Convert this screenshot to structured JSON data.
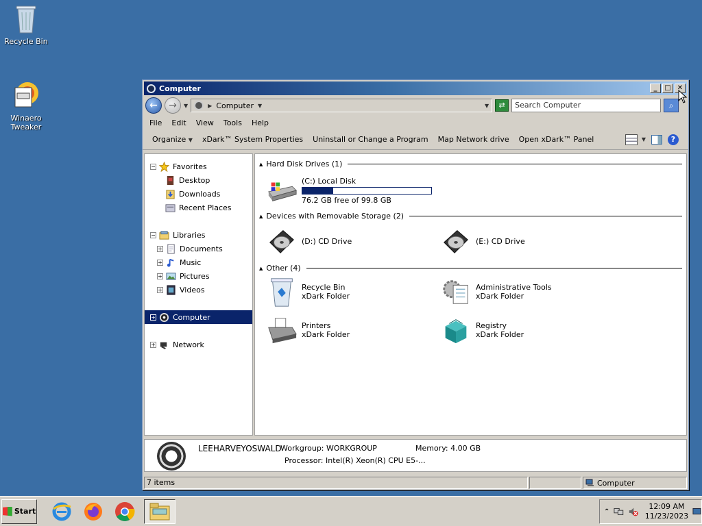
{
  "desktop": {
    "icons": [
      {
        "label": "Recycle Bin"
      },
      {
        "label": "Winaero Tweaker"
      }
    ]
  },
  "window": {
    "title": "Computer",
    "address": {
      "location": "Computer"
    },
    "search_placeholder": "Search Computer",
    "menu": [
      "File",
      "Edit",
      "View",
      "Tools",
      "Help"
    ],
    "commands": [
      "Organize",
      "xDark™ System Properties",
      "Uninstall or Change a Program",
      "Map Network drive",
      "Open xDark™ Panel"
    ],
    "nav": {
      "favorites": {
        "label": "Favorites",
        "items": [
          "Desktop",
          "Downloads",
          "Recent Places"
        ]
      },
      "libraries": {
        "label": "Libraries",
        "items": [
          "Documents",
          "Music",
          "Pictures",
          "Videos"
        ]
      },
      "computer": "Computer",
      "network": "Network"
    },
    "groups": {
      "hdd": {
        "header": "Hard Disk Drives (1)"
      },
      "removable": {
        "header": "Devices with Removable Storage (2)"
      },
      "other": {
        "header": "Other (4)"
      }
    },
    "drives": {
      "c": {
        "name": "(C:) Local Disk",
        "free_text": "76.2 GB free of 99.8 GB",
        "used_fraction": 0.24
      },
      "d": {
        "name": "(D:) CD Drive"
      },
      "e": {
        "name": "(E:) CD Drive"
      }
    },
    "other_items": [
      {
        "name": "Recycle Bin",
        "type": "xDark Folder"
      },
      {
        "name": "Administrative Tools",
        "type": "xDark Folder"
      },
      {
        "name": "Printers",
        "type": "xDark Folder"
      },
      {
        "name": "Registry",
        "type": "xDark Folder"
      }
    ],
    "details": {
      "computer_name": "LEEHARVEYOSWALD",
      "workgroup": "Workgroup: WORKGROUP",
      "memory": "Memory: 4.00 GB",
      "processor": "Processor: Intel(R) Xeon(R) CPU E5-..."
    },
    "status": {
      "items": "7 items",
      "location": "Computer"
    }
  },
  "taskbar": {
    "start_label": "Start",
    "clock_time": "12:09 AM",
    "clock_date": "11/23/2023"
  }
}
